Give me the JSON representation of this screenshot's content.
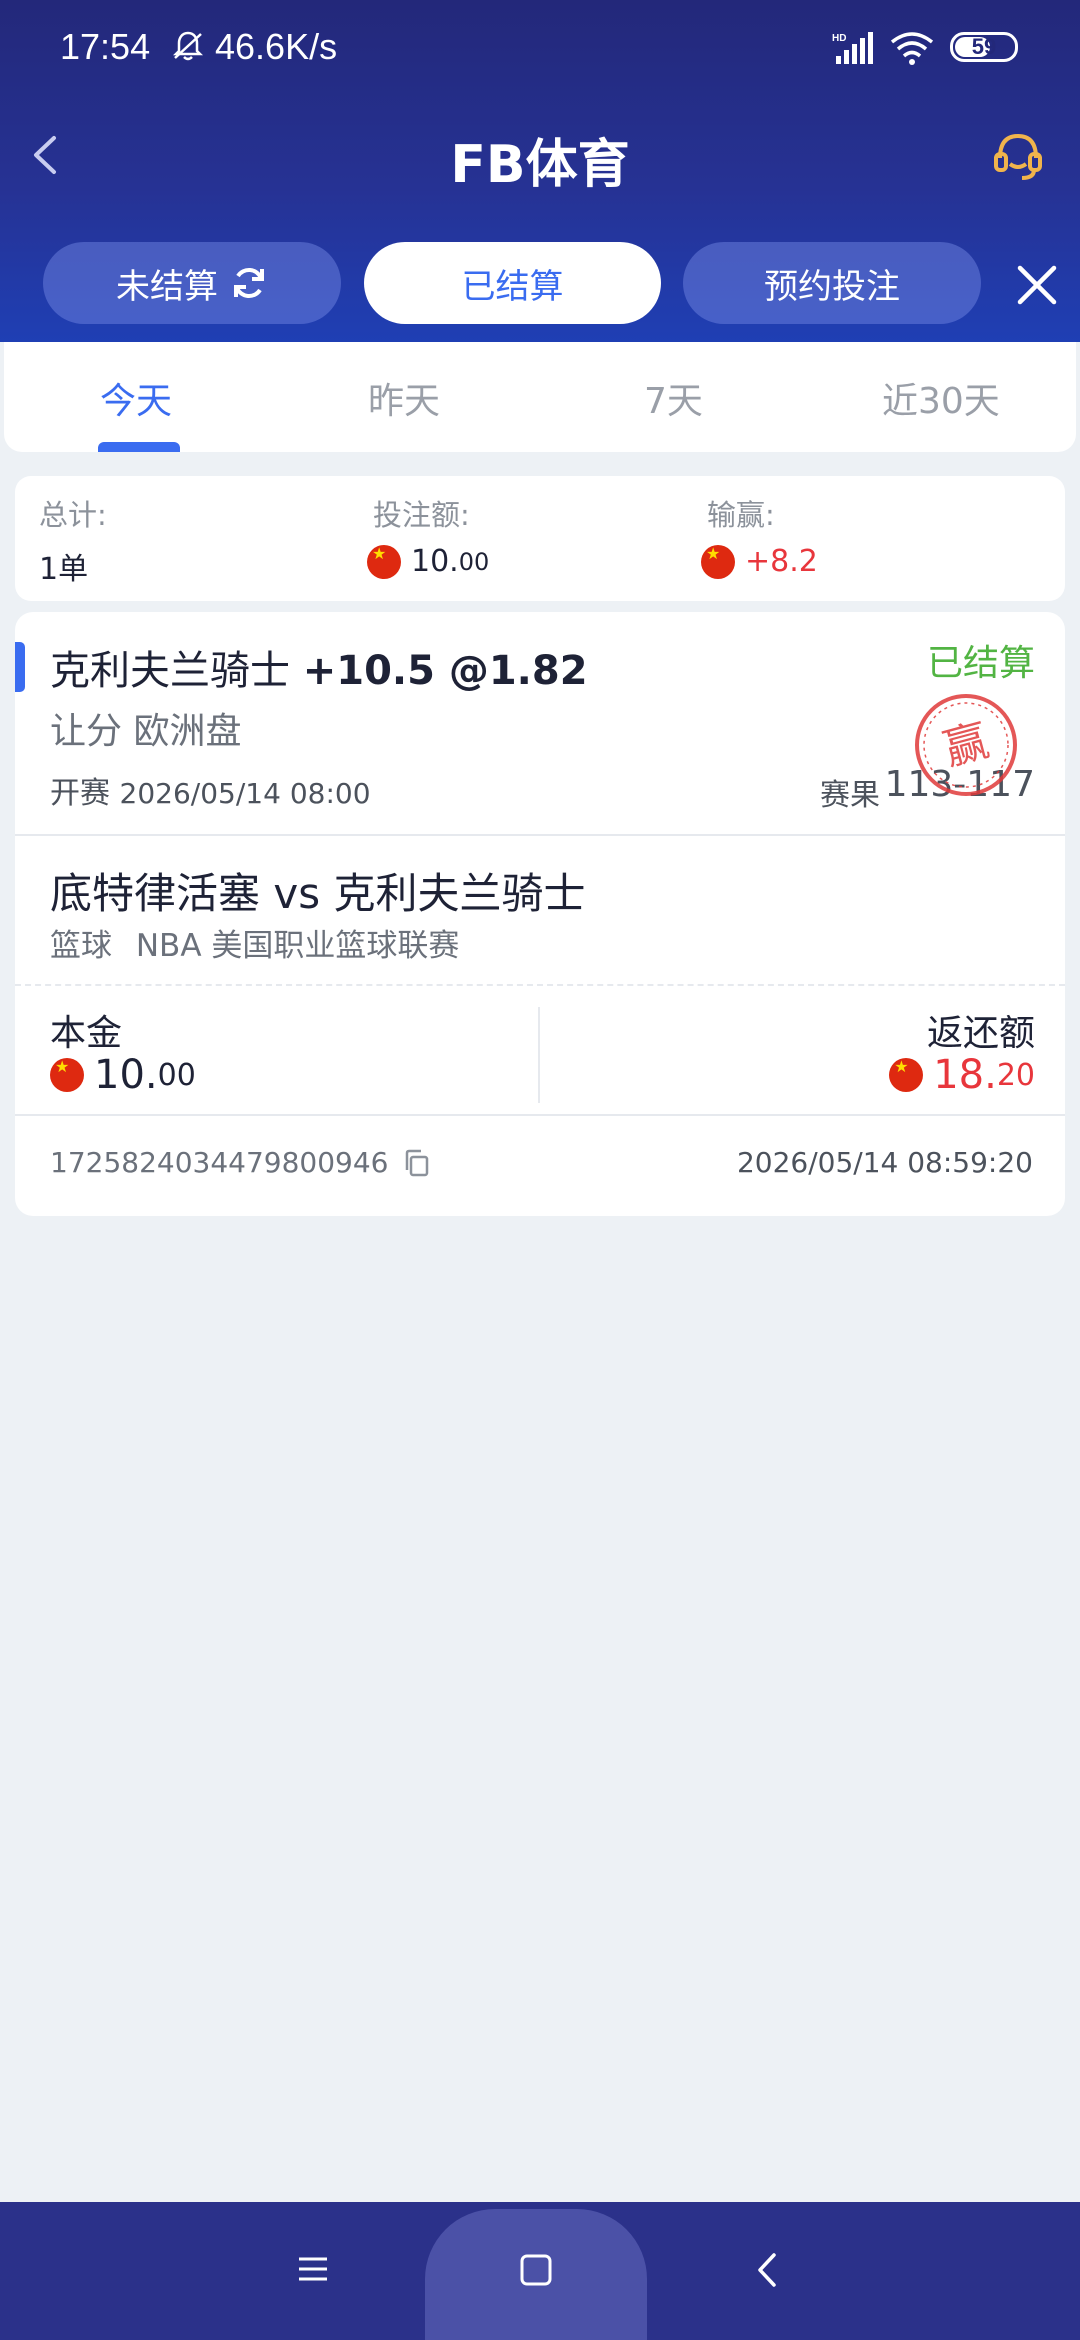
{
  "status_bar": {
    "time": "17:54",
    "speed": "46.6K/s",
    "battery": "59"
  },
  "header": {
    "title": "FB体育"
  },
  "bet_tabs": {
    "unsettled": "未结算",
    "settled": "已结算",
    "reserve": "预约投注",
    "active": "已结算"
  },
  "period_tabs": {
    "items": [
      "今天",
      "昨天",
      "7天",
      "近30天"
    ],
    "active": "今天"
  },
  "summary": {
    "total_label": "总计:",
    "total_value": "1单",
    "stake_label": "投注额:",
    "stake_int": "10.",
    "stake_dec": "00",
    "profit_label": "输赢:",
    "profit_value": "+8.2"
  },
  "bet": {
    "team": "克利夫兰骑士",
    "odds_text": "+10.5 @1.82",
    "status": "已结算",
    "market": "让分 欧洲盘",
    "kickoff_label": "开赛",
    "kickoff_time": "2026/05/14 08:00",
    "score_label": "赛果",
    "score": "113-117",
    "stamp": "赢",
    "matchup": "底特律活塞 vs 克利夫兰骑士",
    "sport": "篮球",
    "league": "NBA 美国职业篮球联赛",
    "principal_label": "本金",
    "principal_int": "10.",
    "principal_dec": "00",
    "return_label": "返还额",
    "return_int": "18.",
    "return_dec": "20",
    "order_id": "1725824034479800946",
    "bet_time": "2026/05/14 08:59:20"
  },
  "colors": {
    "header_bg": "#23287a",
    "accent": "#3a6cf0",
    "win_red": "#e8363c",
    "settled_green": "#52b443",
    "page_bg": "#edf1f5"
  }
}
